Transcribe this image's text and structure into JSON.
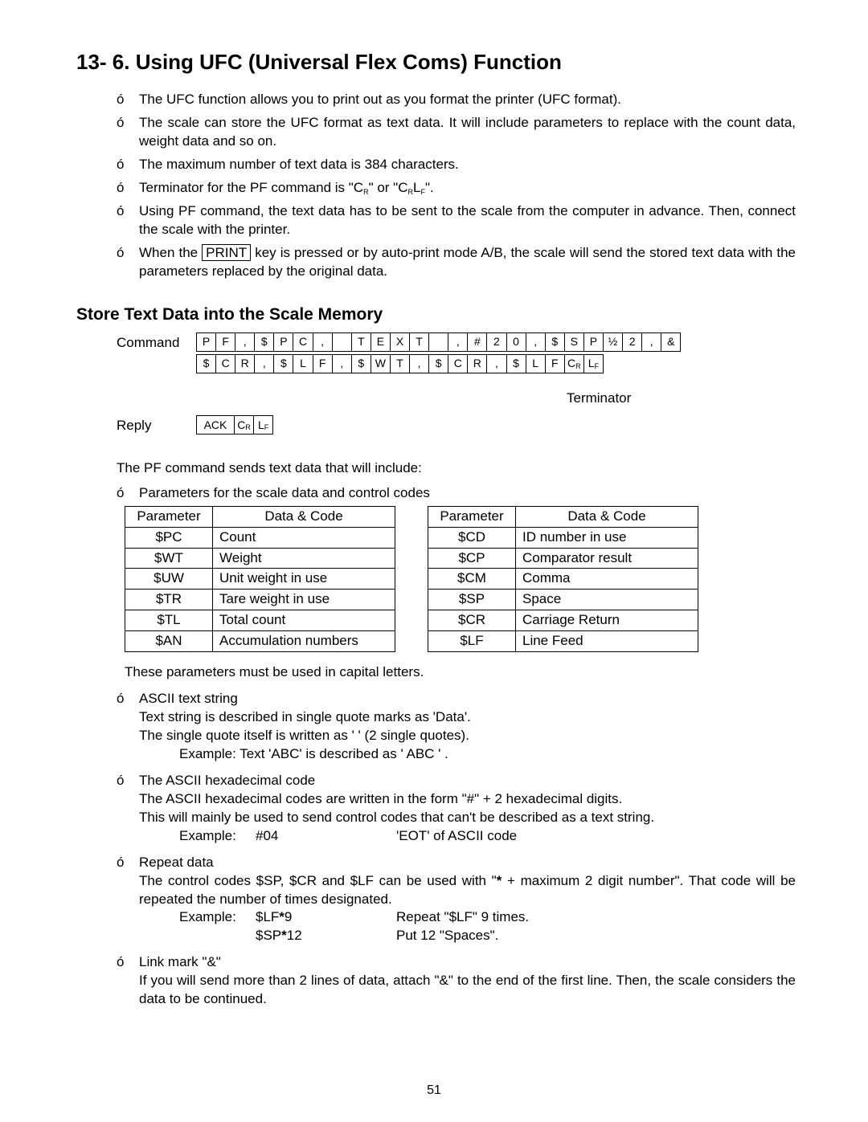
{
  "page_number": "51",
  "h1": "13- 6. Using UFC (Universal Flex Coms) Function",
  "intro": [
    "The UFC function allows you to print out as you format the printer (UFC format).",
    "The scale can store the UFC format as text data. It will include parameters to replace with the count data, weight data and so on.",
    "The maximum number of text data is 384 characters."
  ],
  "terminator_line_pre": "Terminator for the  PF  command is \"C",
  "terminator_line_mid": "\" or \"C",
  "terminator_line_end": "\".",
  "pf_line": "Using  PF  command, the text data has to be sent to the scale from the computer in advance. Then, connect the scale with the printer.",
  "print_pre": "When the ",
  "print_key": "PRINT",
  "print_post": " key is pressed or by auto-print mode A/B, the scale will send the stored text data with the parameters replaced by the original data.",
  "h2_store": "Store Text Data into the Scale Memory",
  "cmd_label": "Command",
  "reply_label": "Reply",
  "cmd_row1": [
    "P",
    "F",
    ",",
    "$",
    "P",
    "C",
    ",",
    "'",
    "T",
    "E",
    "X",
    "T",
    "'",
    ",",
    "#",
    "2",
    "0",
    ",",
    "$",
    "S",
    "P",
    "*",
    "2",
    ",",
    "&"
  ],
  "cmd_row2": [
    "$",
    "C",
    "R",
    ",",
    "$",
    "L",
    "F",
    ",",
    "$",
    "W",
    "T",
    ",",
    "$",
    "C",
    "R",
    ",",
    "$",
    "L",
    "F",
    "CR",
    "LF"
  ],
  "reply_cells": [
    "ACK",
    "CR",
    "LF"
  ],
  "terminator_label": "Terminator",
  "pf_sends": "The  PF  command sends text data that will include:",
  "params_intro": "Parameters for the scale data and control codes",
  "table_headers": [
    "Parameter",
    "Data & Code"
  ],
  "table_left": [
    [
      "$PC",
      "Count"
    ],
    [
      "$WT",
      "Weight"
    ],
    [
      "$UW",
      "Unit weight in use"
    ],
    [
      "$TR",
      "Tare weight in use"
    ],
    [
      "$TL",
      "Total count"
    ],
    [
      "$AN",
      "Accumulation numbers"
    ]
  ],
  "table_right": [
    [
      "$CD",
      "ID number in use"
    ],
    [
      "$CP",
      "Comparator result"
    ],
    [
      "$CM",
      "Comma"
    ],
    [
      "$SP",
      "Space"
    ],
    [
      "$CR",
      "Carriage Return"
    ],
    [
      "$LF",
      "Line Feed"
    ]
  ],
  "caps_note": "These parameters must be used in capital letters.",
  "ascii": {
    "title": "ASCII text string",
    "l1": "Text string is described in single quote marks as  'Data'.",
    "l2": "The single quote itself is written as ' '  (2 single quotes).",
    "ex": "Example:  Text 'ABC' is described as  ' ABC '  ."
  },
  "hex": {
    "title": "The ASCII hexadecimal code",
    "l1": "The ASCII hexadecimal codes are written in the form \"#\" + 2 hexadecimal digits.",
    "l2": "This will mainly be used to send control codes that can't be described as a text string.",
    "ex_label": "Example:",
    "ex_code": "#04",
    "ex_desc": "'EOT' of ASCII code"
  },
  "repeat": {
    "title": "Repeat data",
    "l1a": "The control codes $SP, $CR and $LF can be used with \"",
    "l1b": " + maximum 2 digit number\". That code will be repeated the number of times designated.",
    "ex_label": "Example:",
    "r1c": "$LF*9",
    "r1d": "Repeat \"$LF\" 9 times.",
    "r2c": "$SP*12",
    "r2d": "Put 12 \"Spaces\"."
  },
  "link": {
    "title": "Link mark \"&\"",
    "l1": "If you will send more than 2 lines of data, attach \"&\" to the end of the first line. Then, the scale considers the data to be continued."
  }
}
